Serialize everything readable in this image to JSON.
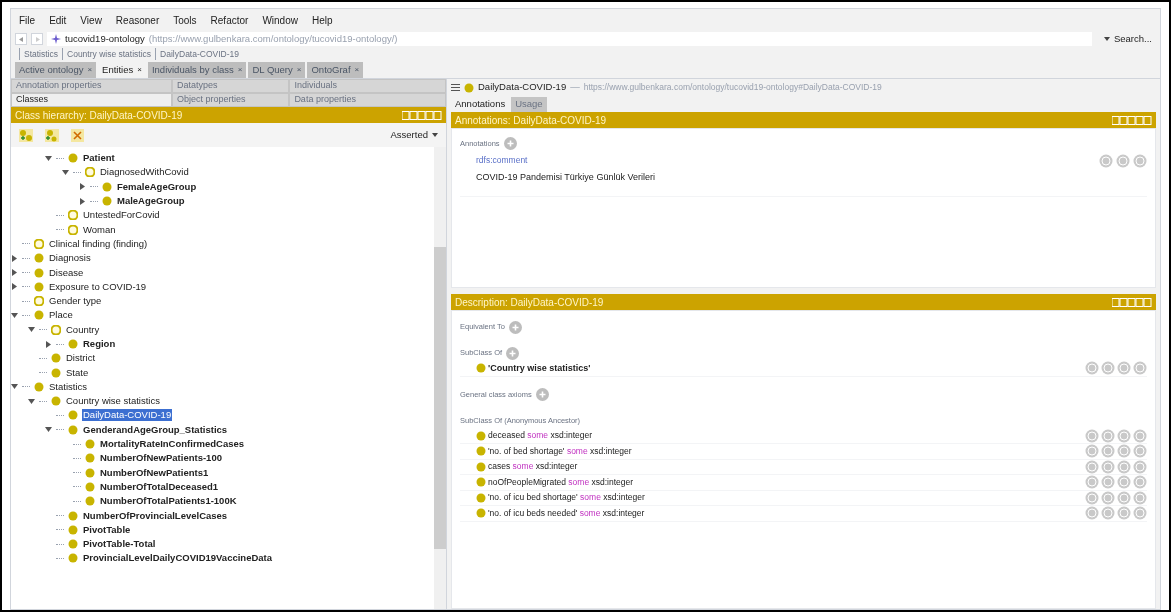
{
  "menu": [
    "File",
    "Edit",
    "View",
    "Reasoner",
    "Tools",
    "Refactor",
    "Window",
    "Help"
  ],
  "address": {
    "ontology": "tucovid19-ontology",
    "iri": "(https://www.gulbenkara.com/ontology/tucovid19-ontology/)",
    "search": "Search..."
  },
  "breadcrumb": [
    "Statistics",
    "Country wise statistics",
    "DailyData-COVID-19"
  ],
  "tabs": [
    {
      "label": "Active ontology",
      "selected": false
    },
    {
      "label": "Entities",
      "selected": true
    },
    {
      "label": "Individuals by class",
      "selected": false
    },
    {
      "label": "DL Query",
      "selected": false
    },
    {
      "label": "OntoGraf",
      "selected": false
    }
  ],
  "tab_close": "×",
  "entity_tabs": [
    [
      {
        "label": "Annotation properties",
        "selected": false
      },
      {
        "label": "Datatypes",
        "selected": false
      },
      {
        "label": "Individuals",
        "selected": false
      }
    ],
    [
      {
        "label": "Classes",
        "selected": true
      },
      {
        "label": "Object properties",
        "selected": false
      },
      {
        "label": "Data properties",
        "selected": false
      }
    ]
  ],
  "class_hierarchy": {
    "title": "Class hierarchy: DailyData-COVID-19",
    "mode": "Asserted",
    "tree": [
      {
        "label": "Patient",
        "kind": "filled",
        "has_children": true,
        "expanded": true,
        "bold": true,
        "selected": false,
        "children": [
          {
            "label": "DiagnosedWithCovid",
            "kind": "hollow",
            "has_children": true,
            "expanded": true,
            "bold": false,
            "selected": false,
            "children": [
              {
                "label": "FemaleAgeGroup",
                "kind": "filled",
                "has_children": true,
                "expanded": false,
                "bold": true,
                "selected": false
              },
              {
                "label": "MaleAgeGroup",
                "kind": "filled",
                "has_children": true,
                "expanded": false,
                "bold": true,
                "selected": false
              }
            ]
          }
        ]
      },
      {
        "label": "UntestedForCovid",
        "kind": "hollow",
        "has_children": false,
        "bold": false,
        "selected": false
      },
      {
        "label": "Woman",
        "kind": "hollow",
        "has_children": false,
        "bold": false,
        "selected": false
      }
    ],
    "tree_root": [
      {
        "label": "Clinical finding (finding)",
        "kind": "hollow",
        "has_children": false,
        "bold": false,
        "selected": false
      },
      {
        "label": "Diagnosis",
        "kind": "filled",
        "has_children": true,
        "expanded": false,
        "bold": false,
        "selected": false
      },
      {
        "label": "Disease",
        "kind": "filled",
        "has_children": true,
        "expanded": false,
        "bold": false,
        "selected": false
      },
      {
        "label": "Exposure to COVID-19",
        "kind": "filled",
        "has_children": true,
        "expanded": false,
        "bold": false,
        "selected": false
      },
      {
        "label": "Gender type",
        "kind": "hollow",
        "has_children": false,
        "bold": false,
        "selected": false
      },
      {
        "label": "Place",
        "kind": "filled",
        "has_children": true,
        "expanded": true,
        "bold": false,
        "selected": false,
        "children": [
          {
            "label": "Country",
            "kind": "hollow",
            "has_children": true,
            "expanded": true,
            "bold": false,
            "selected": false,
            "children": [
              {
                "label": "Region",
                "kind": "filled",
                "has_children": true,
                "expanded": false,
                "bold": true,
                "selected": false
              }
            ]
          },
          {
            "label": "District",
            "kind": "filled",
            "has_children": false,
            "bold": false,
            "selected": false
          },
          {
            "label": "State",
            "kind": "filled",
            "has_children": false,
            "bold": false,
            "selected": false
          }
        ]
      },
      {
        "label": "Statistics",
        "kind": "filled",
        "has_children": true,
        "expanded": true,
        "bold": false,
        "selected": false,
        "children": [
          {
            "label": "Country wise statistics",
            "kind": "filled",
            "has_children": true,
            "expanded": true,
            "bold": false,
            "selected": false,
            "children": [
              {
                "label": "DailyData-COVID-19",
                "kind": "filled",
                "has_children": false,
                "bold": false,
                "selected": true
              },
              {
                "label": "GenderandAgeGroup_Statistics",
                "kind": "filled",
                "has_children": true,
                "expanded": true,
                "bold": true,
                "selected": false,
                "children": [
                  {
                    "label": "MortalityRateInConfirmedCases",
                    "kind": "filled",
                    "has_children": false,
                    "bold": true,
                    "selected": false
                  },
                  {
                    "label": "NumberOfNewPatients-100",
                    "kind": "filled",
                    "has_children": false,
                    "bold": true,
                    "selected": false
                  },
                  {
                    "label": "NumberOfNewPatients1",
                    "kind": "filled",
                    "has_children": false,
                    "bold": true,
                    "selected": false
                  },
                  {
                    "label": "NumberOfTotalDeceased1",
                    "kind": "filled",
                    "has_children": false,
                    "bold": true,
                    "selected": false
                  },
                  {
                    "label": "NumberOfTotalPatients1-100K",
                    "kind": "filled",
                    "has_children": false,
                    "bold": true,
                    "selected": false
                  }
                ]
              },
              {
                "label": "NumberOfProvincialLevelCases",
                "kind": "filled",
                "has_children": false,
                "bold": true,
                "selected": false
              },
              {
                "label": "PivotTable",
                "kind": "filled",
                "has_children": false,
                "bold": true,
                "selected": false
              },
              {
                "label": "PivotTable-Total",
                "kind": "filled",
                "has_children": false,
                "bold": true,
                "selected": false
              },
              {
                "label": "ProvincialLevelDailyCOVID19VaccineData",
                "kind": "filled",
                "has_children": false,
                "bold": true,
                "selected": false
              }
            ]
          }
        ]
      }
    ]
  },
  "entity": {
    "name": "DailyData-COVID-19",
    "dash": "—",
    "iri": "https://www.gulbenkara.com/ontology/tucovid19-ontology#DailyData-COVID-19"
  },
  "view_tabs": [
    {
      "label": "Annotations",
      "selected": true
    },
    {
      "label": "Usage",
      "selected": false
    }
  ],
  "annotations": {
    "title": "Annotations: DailyData-COVID-19",
    "section": "Annotations",
    "items": [
      {
        "property": "rdfs:comment",
        "value": "COVID-19 Pandemisi Türkiye Günlük Verileri"
      }
    ]
  },
  "description": {
    "title": "Description: DailyData-COVID-19",
    "sections": [
      {
        "label": "Equivalent To",
        "addable": true
      },
      {
        "label": "SubClass Of",
        "addable": true,
        "items": [
          {
            "named": "'Country wise statistics'"
          }
        ]
      },
      {
        "label": "General class axioms",
        "addable": true
      },
      {
        "label": "SubClass Of (Anonymous Ancestor)",
        "addable": false,
        "items": [
          {
            "property": "deceased",
            "keyword": "some",
            "filler": "xsd:integer"
          },
          {
            "property": "'no. of bed shortage'",
            "keyword": "some",
            "filler": "xsd:integer"
          },
          {
            "property": "cases",
            "keyword": "some",
            "filler": "xsd:integer"
          },
          {
            "property": "noOfPeopleMigrated",
            "keyword": "some",
            "filler": "xsd:integer"
          },
          {
            "property": "'no. of icu bed shortage'",
            "keyword": "some",
            "filler": "xsd:integer"
          },
          {
            "property": "'no. of icu beds needed'",
            "keyword": "some",
            "filler": "xsd:integer"
          }
        ]
      }
    ]
  }
}
